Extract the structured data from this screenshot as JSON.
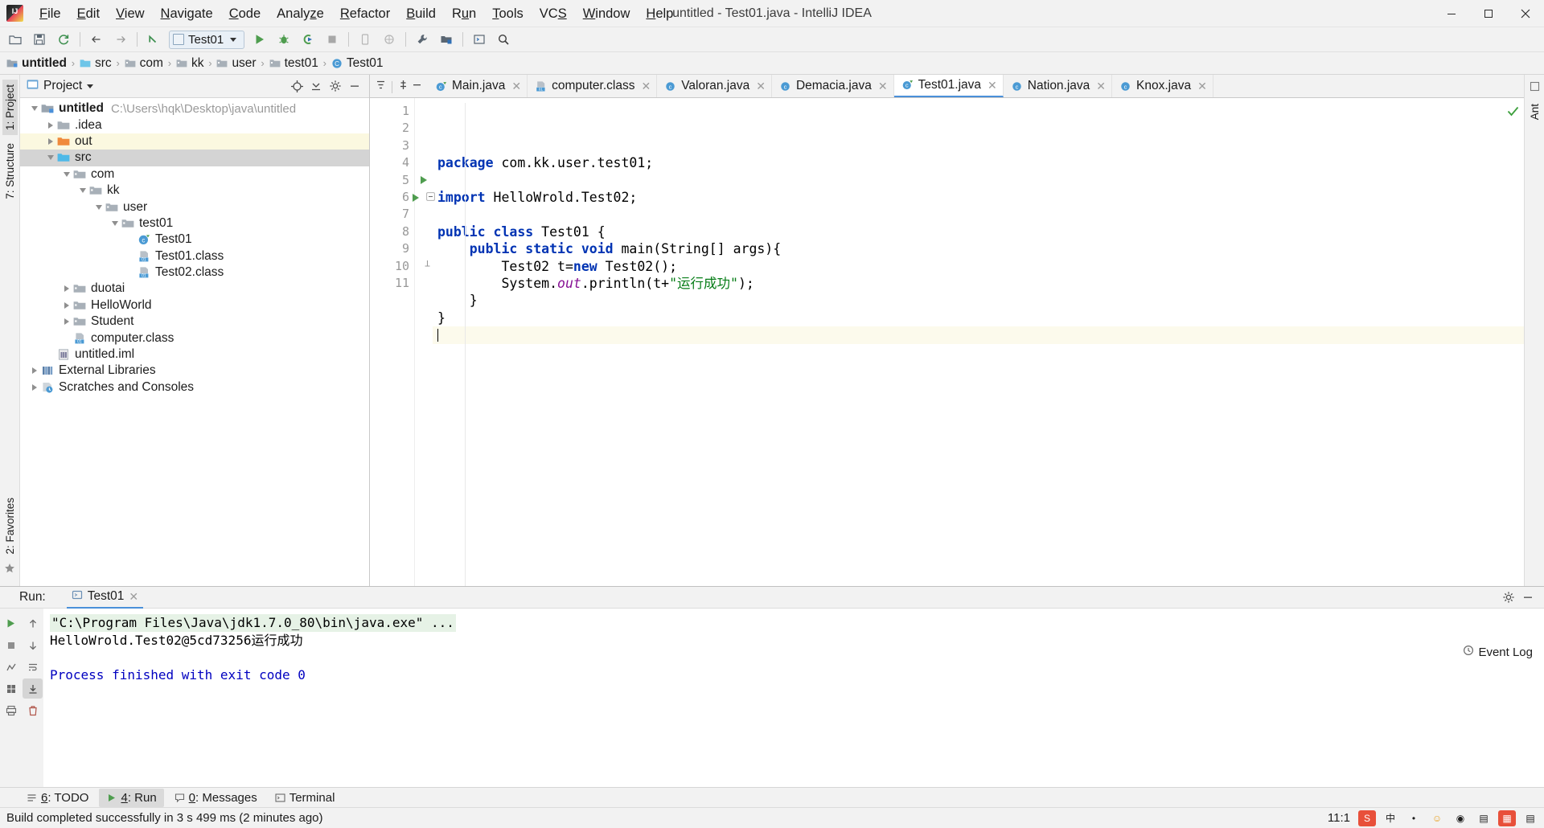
{
  "window": {
    "title": "untitled - Test01.java - IntelliJ IDEA",
    "logo_icon": "intellij-idea-logo",
    "minimize_icon": "minimize-icon",
    "maximize_icon": "maximize-icon",
    "close_icon": "close-icon"
  },
  "menubar": [
    {
      "label": "File",
      "mnemonic": "F",
      "rest": "ile"
    },
    {
      "label": "Edit",
      "mnemonic": "E",
      "rest": "dit"
    },
    {
      "label": "View",
      "mnemonic": "V",
      "rest": "iew"
    },
    {
      "label": "Navigate",
      "mnemonic": "N",
      "rest": "avigate"
    },
    {
      "label": "Code",
      "mnemonic": "C",
      "rest": "ode"
    },
    {
      "label": "Analyze",
      "mnemonic": "z",
      "pre": "Analy",
      "rest": "e"
    },
    {
      "label": "Refactor",
      "mnemonic": "R",
      "rest": "efactor"
    },
    {
      "label": "Build",
      "mnemonic": "B",
      "rest": "uild"
    },
    {
      "label": "Run",
      "mnemonic": "u",
      "pre": "R",
      "rest": "n"
    },
    {
      "label": "Tools",
      "mnemonic": "T",
      "rest": "ools"
    },
    {
      "label": "VCS",
      "mnemonic": "S",
      "pre": "VC",
      "rest": ""
    },
    {
      "label": "Window",
      "mnemonic": "W",
      "rest": "indow"
    },
    {
      "label": "Help",
      "mnemonic": "H",
      "rest": "elp"
    }
  ],
  "toolbar": {
    "buttons": [
      {
        "name": "open-folder-icon",
        "glyph": "open"
      },
      {
        "name": "save-all-icon",
        "glyph": "save"
      },
      {
        "name": "sync-refresh-icon",
        "glyph": "sync"
      },
      {
        "name": "back-icon",
        "glyph": "back"
      },
      {
        "name": "forward-icon",
        "glyph": "forward"
      },
      {
        "name": "undo-icon",
        "glyph": "undo"
      }
    ],
    "run_config": {
      "label": "Test01",
      "icon": "run-config-icon"
    },
    "actions": [
      {
        "name": "run-button",
        "glyph": "run"
      },
      {
        "name": "debug-button",
        "glyph": "debug"
      },
      {
        "name": "run-with-coverage-button",
        "glyph": "coverage"
      },
      {
        "name": "stop-button",
        "glyph": "stop"
      },
      {
        "name": "android-device-button",
        "glyph": "device"
      },
      {
        "name": "avd-manager-button",
        "glyph": "avd"
      },
      {
        "name": "settings-wrench-button",
        "glyph": "wrench"
      },
      {
        "name": "project-structure-button",
        "glyph": "structure"
      },
      {
        "name": "terminal-button",
        "glyph": "terminal"
      },
      {
        "name": "search-everywhere-button",
        "glyph": "search"
      }
    ]
  },
  "breadcrumb": [
    {
      "label": "untitled",
      "icon": "project-icon",
      "bold": true
    },
    {
      "label": "src",
      "icon": "folder-icon",
      "bold": false
    },
    {
      "label": "com",
      "icon": "package-icon",
      "bold": false
    },
    {
      "label": "kk",
      "icon": "package-icon",
      "bold": false
    },
    {
      "label": "user",
      "icon": "package-icon",
      "bold": false
    },
    {
      "label": "test01",
      "icon": "package-icon",
      "bold": false
    },
    {
      "label": "Test01",
      "icon": "java-class-icon",
      "bold": false
    }
  ],
  "left_rail": {
    "top": [
      {
        "label": "1: Project",
        "name": "rail-tab-project",
        "active": true
      }
    ],
    "mid": [
      {
        "label": "7: Structure",
        "name": "rail-tab-structure",
        "active": false
      }
    ],
    "bottom": [
      {
        "label": "2: Favorites",
        "name": "rail-tab-favorites",
        "active": false
      }
    ]
  },
  "right_rail": {
    "top": [
      {
        "label": "Ant",
        "name": "rail-tab-ant",
        "active": false
      }
    ]
  },
  "project_panel": {
    "title": "Project",
    "header_icons": [
      "locate-icon",
      "collapse-all-icon",
      "settings-gear-icon",
      "hide-icon"
    ],
    "tree": [
      {
        "indent": 0,
        "twist": "down",
        "icon": "project-root-icon",
        "label": "untitled",
        "bold": true,
        "path": "C:\\Users\\hqk\\Desktop\\java\\untitled",
        "state": "none"
      },
      {
        "indent": 1,
        "twist": "right",
        "icon": "folder-gray-icon",
        "label": ".idea",
        "bold": false,
        "path": "",
        "state": "none"
      },
      {
        "indent": 1,
        "twist": "right",
        "icon": "folder-orange-icon",
        "label": "out",
        "bold": false,
        "path": "",
        "state": "highlight"
      },
      {
        "indent": 1,
        "twist": "down",
        "icon": "folder-source-icon",
        "label": "src",
        "bold": false,
        "path": "",
        "state": "selected"
      },
      {
        "indent": 2,
        "twist": "down",
        "icon": "package-icon",
        "label": "com",
        "bold": false,
        "path": "",
        "state": "none"
      },
      {
        "indent": 3,
        "twist": "down",
        "icon": "package-icon",
        "label": "kk",
        "bold": false,
        "path": "",
        "state": "none"
      },
      {
        "indent": 4,
        "twist": "down",
        "icon": "package-icon",
        "label": "user",
        "bold": false,
        "path": "",
        "state": "none"
      },
      {
        "indent": 5,
        "twist": "down",
        "icon": "package-icon",
        "label": "test01",
        "bold": false,
        "path": "",
        "state": "none"
      },
      {
        "indent": 6,
        "twist": "none",
        "icon": "java-class-icon",
        "label": "Test01",
        "bold": false,
        "path": "",
        "state": "none"
      },
      {
        "indent": 6,
        "twist": "none",
        "icon": "class-file-icon",
        "label": "Test01.class",
        "bold": false,
        "path": "",
        "state": "none"
      },
      {
        "indent": 6,
        "twist": "none",
        "icon": "class-file-icon",
        "label": "Test02.class",
        "bold": false,
        "path": "",
        "state": "none"
      },
      {
        "indent": 2,
        "twist": "right",
        "icon": "package-icon",
        "label": "duotai",
        "bold": false,
        "path": "",
        "state": "none"
      },
      {
        "indent": 2,
        "twist": "right",
        "icon": "package-icon",
        "label": "HelloWorld",
        "bold": false,
        "path": "",
        "state": "none"
      },
      {
        "indent": 2,
        "twist": "right",
        "icon": "package-icon",
        "label": "Student",
        "bold": false,
        "path": "",
        "state": "none"
      },
      {
        "indent": 2,
        "twist": "none",
        "icon": "class-file-icon",
        "label": "computer.class",
        "bold": false,
        "path": "",
        "state": "none"
      },
      {
        "indent": 1,
        "twist": "none",
        "icon": "iml-file-icon",
        "label": "untitled.iml",
        "bold": false,
        "path": "",
        "state": "none"
      },
      {
        "indent": 0,
        "twist": "right",
        "icon": "libraries-icon",
        "label": "External Libraries",
        "bold": false,
        "path": "",
        "state": "none"
      },
      {
        "indent": 0,
        "twist": "right",
        "icon": "scratches-icon",
        "label": "Scratches and Consoles",
        "bold": false,
        "path": "",
        "state": "none"
      }
    ]
  },
  "editor_tabs": [
    {
      "label": "Main.java",
      "icon": "java-runnable-class-icon",
      "active": false
    },
    {
      "label": "computer.class",
      "icon": "class-file-icon",
      "active": false
    },
    {
      "label": "Valoran.java",
      "icon": "java-class-icon",
      "active": false
    },
    {
      "label": "Demacia.java",
      "icon": "java-class-icon",
      "active": false
    },
    {
      "label": "Test01.java",
      "icon": "java-runnable-class-icon",
      "active": true
    },
    {
      "label": "Nation.java",
      "icon": "java-class-icon",
      "active": false
    },
    {
      "label": "Knox.java",
      "icon": "java-class-icon",
      "active": false
    }
  ],
  "editor": {
    "inspection_status_icon": "inspection-ok-check",
    "lines": [
      {
        "num": "1",
        "runmark": false,
        "fold": "none",
        "current": false,
        "tokens": [
          {
            "t": "kw",
            "v": "package"
          },
          {
            "t": "p",
            "v": " com.kk.user.test01;"
          }
        ]
      },
      {
        "num": "2",
        "runmark": false,
        "fold": "none",
        "current": false,
        "tokens": []
      },
      {
        "num": "3",
        "runmark": false,
        "fold": "none",
        "current": false,
        "tokens": [
          {
            "t": "kw",
            "v": "import"
          },
          {
            "t": "p",
            "v": " HelloWrold.Test02;"
          }
        ]
      },
      {
        "num": "4",
        "runmark": false,
        "fold": "none",
        "current": false,
        "tokens": []
      },
      {
        "num": "5",
        "runmark": true,
        "fold": "none",
        "current": false,
        "tokens": [
          {
            "t": "kw",
            "v": "public class"
          },
          {
            "t": "p",
            "v": " Test01 {"
          }
        ]
      },
      {
        "num": "6",
        "runmark": true,
        "fold": "open",
        "current": false,
        "tokens": [
          {
            "t": "p",
            "v": "    "
          },
          {
            "t": "kw",
            "v": "public static void"
          },
          {
            "t": "p",
            "v": " main(String[] args){"
          }
        ]
      },
      {
        "num": "7",
        "runmark": false,
        "fold": "none",
        "current": false,
        "tokens": [
          {
            "t": "p",
            "v": "        Test02 t="
          },
          {
            "t": "kw",
            "v": "new"
          },
          {
            "t": "p",
            "v": " Test02();"
          }
        ]
      },
      {
        "num": "8",
        "runmark": false,
        "fold": "none",
        "current": false,
        "tokens": [
          {
            "t": "p",
            "v": "        System."
          },
          {
            "t": "fld",
            "v": "out"
          },
          {
            "t": "p",
            "v": ".println(t+"
          },
          {
            "t": "str",
            "v": "\"运行成功\""
          },
          {
            "t": "p",
            "v": ");"
          }
        ]
      },
      {
        "num": "9",
        "runmark": false,
        "fold": "none",
        "current": false,
        "tokens": [
          {
            "t": "p",
            "v": "    }"
          }
        ]
      },
      {
        "num": "10",
        "runmark": false,
        "fold": "close",
        "current": false,
        "tokens": [
          {
            "t": "p",
            "v": "}"
          }
        ]
      },
      {
        "num": "11",
        "runmark": false,
        "fold": "none",
        "current": true,
        "tokens": [],
        "caret": true
      }
    ]
  },
  "run_panel": {
    "label": "Run:",
    "tab_label": "Test01",
    "tab_icon": "run-tab-icon",
    "settings_icon": "gear-icon",
    "hide_icon": "minimize-panel-icon",
    "sidebar": [
      {
        "name": "rerun-button",
        "glyph": "rerun"
      },
      {
        "name": "scroll-up-button",
        "glyph": "up"
      },
      {
        "name": "stop-button",
        "glyph": "stop"
      },
      {
        "name": "scroll-down-button",
        "glyph": "down"
      },
      {
        "name": "trace-button",
        "glyph": "trace"
      },
      {
        "name": "soft-wrap-button",
        "glyph": "wrap"
      },
      {
        "name": "show-output-button",
        "glyph": "grid"
      },
      {
        "name": "scroll-to-end-button",
        "glyph": "scroll-end",
        "active": true
      },
      {
        "name": "print-button",
        "glyph": "print"
      },
      {
        "name": "clear-all-button",
        "glyph": "trash"
      }
    ],
    "console": [
      {
        "style": "command",
        "text": "\"C:\\Program Files\\Java\\jdk1.7.0_80\\bin\\java.exe\" ..."
      },
      {
        "style": "plain",
        "text": "HelloWrold.Test02@5cd73256运行成功"
      },
      {
        "style": "blank",
        "text": ""
      },
      {
        "style": "blue",
        "text": "Process finished with exit code 0"
      }
    ]
  },
  "bottom_tabs": [
    {
      "label": "6: TODO",
      "num": "6",
      "rest": ": TODO",
      "icon": "todo-icon",
      "active": false
    },
    {
      "label": "4: Run",
      "num": "4",
      "rest": ": Run",
      "icon": "run-icon",
      "active": true
    },
    {
      "label": "0: Messages",
      "num": "0",
      "rest": ": Messages",
      "icon": "messages-icon",
      "active": false
    },
    {
      "label": "Terminal",
      "num": "",
      "rest": "Terminal",
      "icon": "terminal-icon",
      "active": false
    }
  ],
  "statusbar": {
    "message": "Build completed successfully in 3 s 499 ms (2 minutes ago)",
    "caret_position": "11:1",
    "event_log": "Event Log",
    "tray": [
      {
        "name": "sogou-ime-icon",
        "glyph": "S",
        "color": "#e8503a"
      },
      {
        "name": "ime-chinese-icon",
        "glyph": "中",
        "color": "#f2f2f2",
        "text": "#1c1c1c"
      },
      {
        "name": "ime-halfwidth-icon",
        "glyph": "•",
        "color": "#f2f2f2",
        "text": "#1c1c1c"
      },
      {
        "name": "ime-smiley-icon",
        "glyph": "☺",
        "color": "#f2f2f2",
        "text": "#e8a020"
      },
      {
        "name": "ime-mic-icon",
        "glyph": "◉",
        "color": "#f2f2f2",
        "text": "#1c1c1c"
      },
      {
        "name": "ime-keyboard-icon",
        "glyph": "▤",
        "color": "#f2f2f2",
        "text": "#1c1c1c"
      },
      {
        "name": "ime-toolbox-icon",
        "glyph": "▦",
        "color": "#e8503a",
        "text": "#ffffff"
      },
      {
        "name": "ime-menu-icon",
        "glyph": "▤",
        "color": "#f2f2f2",
        "text": "#1c1c1c"
      }
    ]
  },
  "colors": {
    "accent_blue": "#4a90d9",
    "keyword": "#0033b3",
    "string": "#067d17",
    "field": "#871094",
    "run_green": "#4f9d4f",
    "panel_bg": "#f2f2f2",
    "selection": "#d4d4d4",
    "highlight_row": "#fbf8e0"
  }
}
